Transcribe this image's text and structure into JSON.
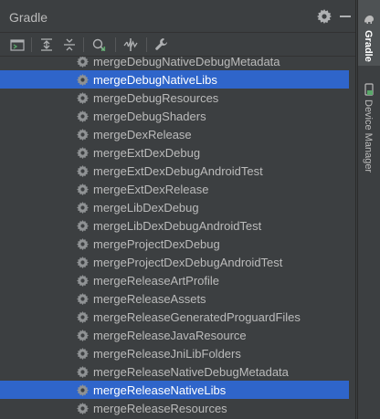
{
  "panel": {
    "title": "Gradle"
  },
  "toolbar": {
    "buttons": [
      "refresh",
      "expand-all",
      "collapse-all",
      "analyze",
      "toggle-offline",
      "settings"
    ]
  },
  "tree": {
    "items": [
      {
        "label": "mergeDebugNativeDebugMetadata",
        "selected": false
      },
      {
        "label": "mergeDebugNativeLibs",
        "selected": true
      },
      {
        "label": "mergeDebugResources",
        "selected": false
      },
      {
        "label": "mergeDebugShaders",
        "selected": false
      },
      {
        "label": "mergeDexRelease",
        "selected": false
      },
      {
        "label": "mergeExtDexDebug",
        "selected": false
      },
      {
        "label": "mergeExtDexDebugAndroidTest",
        "selected": false
      },
      {
        "label": "mergeExtDexRelease",
        "selected": false
      },
      {
        "label": "mergeLibDexDebug",
        "selected": false
      },
      {
        "label": "mergeLibDexDebugAndroidTest",
        "selected": false
      },
      {
        "label": "mergeProjectDexDebug",
        "selected": false
      },
      {
        "label": "mergeProjectDexDebugAndroidTest",
        "selected": false
      },
      {
        "label": "mergeReleaseArtProfile",
        "selected": false
      },
      {
        "label": "mergeReleaseAssets",
        "selected": false
      },
      {
        "label": "mergeReleaseGeneratedProguardFiles",
        "selected": false
      },
      {
        "label": "mergeReleaseJavaResource",
        "selected": false
      },
      {
        "label": "mergeReleaseJniLibFolders",
        "selected": false
      },
      {
        "label": "mergeReleaseNativeDebugMetadata",
        "selected": false
      },
      {
        "label": "mergeReleaseNativeLibs",
        "selected": true
      },
      {
        "label": "mergeReleaseResources",
        "selected": false
      }
    ]
  },
  "sidebar": {
    "gradle_label": "Gradle",
    "device_manager_label": "Device Manager"
  },
  "colors": {
    "background": "#3c3f41",
    "selection": "#2f65ca",
    "text": "#bbbbbb",
    "selected_text": "#ffffff"
  }
}
